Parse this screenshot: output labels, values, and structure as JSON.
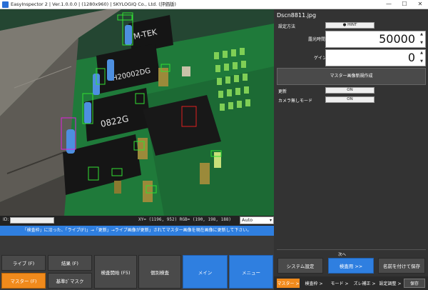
{
  "window": {
    "title": "EasyInspector 2 | Ver.1.0.0.0 | (1280x960) | SKYLOGIQ Co., Ltd. (評価版)",
    "min": "—",
    "max": "☐",
    "close": "✕"
  },
  "viewport": {
    "image_alt": "PCB board with chips and capacitors",
    "chip_labels": {
      "a": "M-TEK",
      "b": "H20002DG",
      "c": "0822G"
    }
  },
  "status": {
    "id_label": "ID:",
    "coords": "XY= (1196, 952) RGB= (190, 198, 188)",
    "zoom_value": "Auto",
    "chevron": "▾"
  },
  "infobar": {
    "text": "「検査枠」に沿った、「ライブ(F)」→「更新」→ライブ画像が更新」されてマスター画像を現在画像に更新して下さい。"
  },
  "bottom_buttons": {
    "live": "ライブ (F)",
    "result": "結果 (F)",
    "master": "マスター (F)",
    "setmask": "基準ｶﾞマスク",
    "start_inspect": "検査開始 (F5)",
    "individual": "個別検査",
    "main": "メイン",
    "menu": "メニュー"
  },
  "right": {
    "filename": "Dscn8811.jpg",
    "setting_method": "設定方法",
    "hint": "● HINT",
    "exposure_label": "露光時間",
    "exposure_value": "50000",
    "gain_label": "ゲイン",
    "gain_value": "0",
    "spin_up": "▲",
    "spin_down": "▼",
    "master_create": "マスター画像新規作成",
    "update_label": "更新",
    "update_toggle": "ON",
    "camera_mode_label": "カメラ無しモード",
    "camera_mode_toggle": "ON",
    "next_label": "次へ",
    "system_settings": "システム設定",
    "inspect_next": "検査用 >>",
    "save_named": "名前を付けて保存"
  },
  "tabs": [
    {
      "label": "マスター >"
    },
    {
      "label": "検査枠 >"
    },
    {
      "label": "モード >"
    },
    {
      "label": "ズレ補正 >"
    },
    {
      "label": "設定調整 >"
    }
  ],
  "save_label": "保存",
  "colors": {
    "accent_blue": "#2f7fe0",
    "accent_orange": "#f08a1c",
    "roi_green": "#32e032",
    "roi_red": "#e02020",
    "roi_magenta": "#e020e0"
  }
}
